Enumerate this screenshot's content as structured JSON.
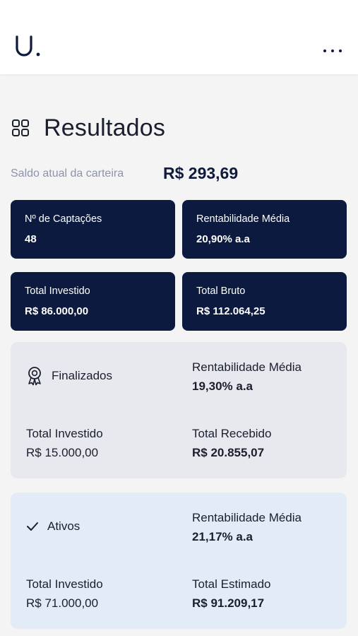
{
  "header": {
    "logo_text": "U."
  },
  "page": {
    "title": "Resultados"
  },
  "saldo": {
    "label": "Saldo atual da carteira",
    "value": "R$ 293,69"
  },
  "stats": [
    {
      "label": "Nº de Captações",
      "value": "48"
    },
    {
      "label": "Rentabilidade Média",
      "value": "20,90% a.a"
    },
    {
      "label": "Total Investido",
      "value": "R$ 86.000,00"
    },
    {
      "label": "Total Bruto",
      "value": "R$ 112.064,25"
    }
  ],
  "finalizados": {
    "title": "Finalizados",
    "icon": "award-icon",
    "rentabilidade_label": "Rentabilidade Média",
    "rentabilidade_value": "19,30% a.a",
    "investido_label": "Total Investido",
    "investido_value": "R$ 15.000,00",
    "recebido_label": "Total Recebido",
    "recebido_value": "R$ 20.855,07"
  },
  "ativos": {
    "title": "Ativos",
    "icon": "check-icon",
    "rentabilidade_label": "Rentabilidade Média",
    "rentabilidade_value": "21,17% a.a",
    "investido_label": "Total Investido",
    "investido_value": "R$ 71.000,00",
    "estimado_label": "Total Estimado",
    "estimado_value": "R$ 91.209,17"
  },
  "colors": {
    "navy": "#0b1a3e",
    "finalizados_bg": "#e7e9ee",
    "ativos_bg": "#e3ebf7",
    "muted": "#8b93ad"
  }
}
